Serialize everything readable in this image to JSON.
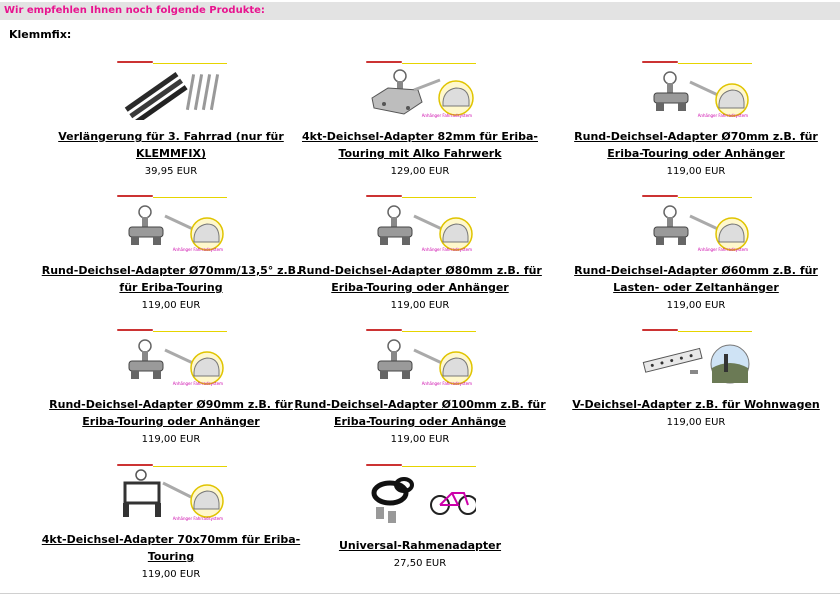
{
  "header": {
    "text": "Wir empfehlen Ihnen noch folgende Produkte:"
  },
  "section": {
    "title": "Klemmfix:"
  },
  "products": [
    {
      "name": "Verlängerung für 3. Fahrrad (nur für KLEMMFIX)",
      "price": "39,95 EUR",
      "image": "rails-image"
    },
    {
      "name": "4kt-Deichsel-Adapter 82mm für Eriba-Touring mit Alko Fahrwerk",
      "price": "129,00 EUR",
      "image": "adapter-image"
    },
    {
      "name": "Rund-Deichsel-Adapter Ø70mm z.B. für Eriba-Touring oder Anhänger",
      "price": "119,00 EUR",
      "image": "adapter-image"
    },
    {
      "name": "Rund-Deichsel-Adapter Ø70mm/13,5° z.B. für Eriba-Touring",
      "price": "119,00 EUR",
      "image": "adapter-image"
    },
    {
      "name": "Rund-Deichsel-Adapter Ø80mm z.B. für Eriba-Touring oder Anhänger",
      "price": "119,00 EUR",
      "image": "adapter-image"
    },
    {
      "name": "Rund-Deichsel-Adapter Ø60mm z.B. für Lasten- oder Zeltanhänger",
      "price": "119,00 EUR",
      "image": "adapter-image"
    },
    {
      "name": "Rund-Deichsel-Adapter Ø90mm z.B. für Eriba-Touring oder Anhänger",
      "price": "119,00 EUR",
      "image": "adapter-image"
    },
    {
      "name": "Rund-Deichsel-Adapter Ø100mm z.B. für Eriba-Touring oder Anhänge",
      "price": "119,00 EUR",
      "image": "adapter-image"
    },
    {
      "name": "V-Deichsel-Adapter z.B. für Wohnwagen",
      "price": "119,00 EUR",
      "image": "v-adapter-image"
    },
    {
      "name": "4kt-Deichsel-Adapter 70x70mm für Eriba-Touring",
      "price": "119,00 EUR",
      "image": "square-adapter-image"
    },
    {
      "name": "Universal-Rahmenadapter",
      "price": "27,50 EUR",
      "image": "frame-adapter-image"
    }
  ]
}
